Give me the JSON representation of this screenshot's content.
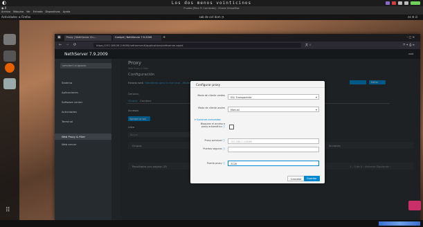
{
  "host": {
    "title": "Los dos menos vointicinos",
    "vm_title": "Prueba [Pero © Corriendo] - Oracle VirtualBox",
    "menus": [
      "Archivo",
      "Máquina",
      "Ver",
      "Entrada",
      "Dispositivos",
      "Ayuda"
    ],
    "guest_bar_left": "Actividades   ⊕ Firefox",
    "guest_bar_center": "sab de oct dom  ◔",
    "guest_bar_right": "es  ⚙  ⏻"
  },
  "browser": {
    "tab1": "Proxy | NethServer Clu...",
    "tab2": "Cockpit | NethServer 7.9.2009",
    "tab_close": "×",
    "tab_new": "+",
    "url": "https://192.168.56.2:9090/nethserver#/applications/nethserver-squid",
    "back": "←",
    "forward": "→",
    "reload": "⟳"
  },
  "nethserver": {
    "brand": "NethServer 7.9.2009",
    "user": "root",
    "sidebar_search": "servidor1.ei.ignacio",
    "sidebar_items": [
      "Sistema",
      "Aplicaciones",
      "Software center",
      "Actividades",
      "Terminal",
      "Web Proxy & filter",
      "Web server"
    ],
    "page_title": "Proxy",
    "page_subtitle": "Web Proxy & filter",
    "section": "Configuración",
    "status_label": "Estado web",
    "status_text": "Habilitado para la red local - Modo transparente",
    "details_label": "Detalles",
    "tab_groups": "Grupos",
    "tab_filters": "Cambios",
    "access_label": "Accesos",
    "add_group_button": "Agregar grupo",
    "list_label": "Lista",
    "search_placeholder": "Buscar",
    "groups_column": "Grupos",
    "actions_column": "Acciones",
    "pagination": "Resultados por página: 25",
    "pager": "1 - 0 de 0   ‹ Anterior  Siguiente ›",
    "config_button": "Editar"
  },
  "modal": {
    "title": "Configurar proxy",
    "mode_label": "Modo de cliente verdes",
    "mode_value": "SSL Transparente",
    "mode_label2": "Modo de cliente azules",
    "mode_value2": "Manual",
    "advanced_toggle": "Opciones avanzadas",
    "bypass_label": "Bloquear el acceso a proxy automático",
    "parent_proxy_label": "Proxy principal",
    "parent_proxy_placeholder": "192.168.1.1:8080",
    "safe_ports_label": "Puertos seguros",
    "safe_ports_value": "",
    "proxy_port_label": "Puerto proxy",
    "proxy_port_value": "3128",
    "cancel_button": "Cancelar",
    "save_button": "Guardar"
  },
  "colors": {
    "accent": "#0088ce",
    "link": "#39a5dc"
  }
}
